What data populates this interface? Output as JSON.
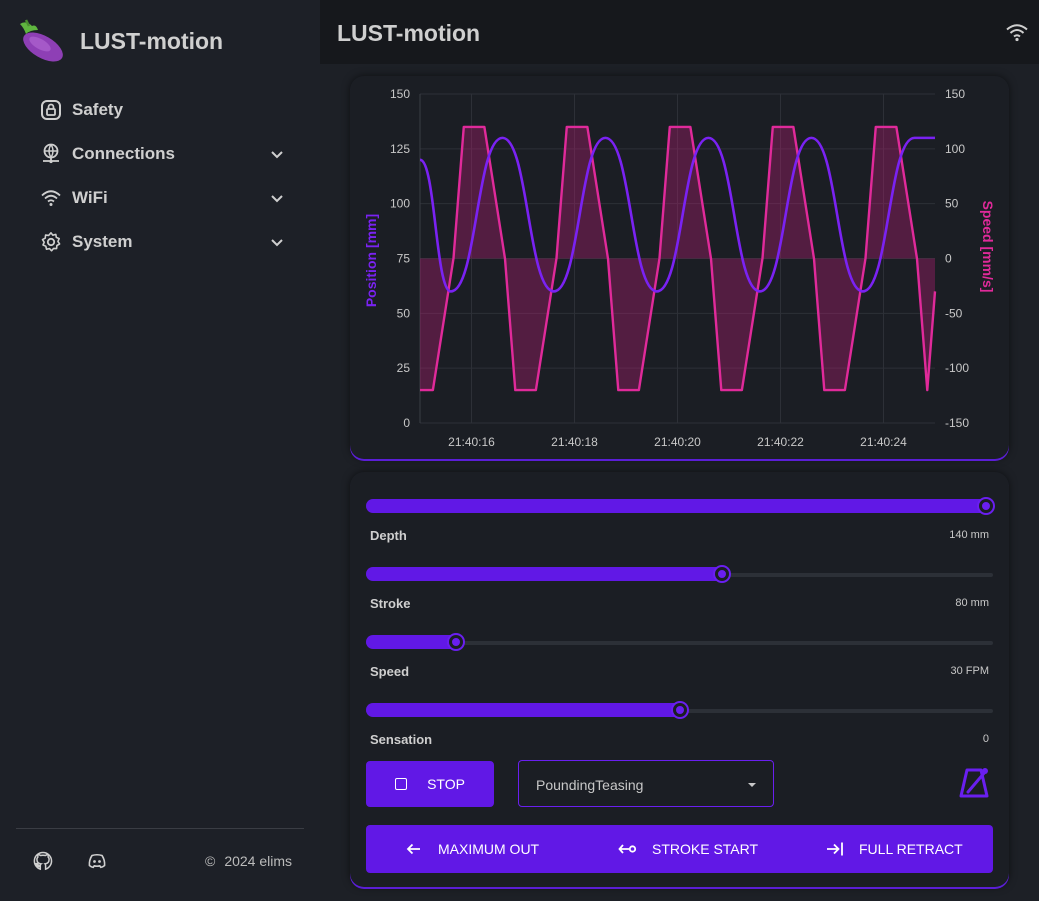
{
  "app": {
    "title": "LUST-motion"
  },
  "sidebar": {
    "items": [
      {
        "label": "Safety",
        "icon": "lock-icon"
      },
      {
        "label": "Connections",
        "icon": "network-icon"
      },
      {
        "label": "WiFi",
        "icon": "wifi-icon"
      },
      {
        "label": "System",
        "icon": "gear-icon"
      }
    ],
    "footer": {
      "copyright": "2024 elims",
      "icons": [
        "github-icon",
        "discord-icon"
      ]
    }
  },
  "header": {
    "title": "LUST-motion",
    "status_icon": "wifi-icon"
  },
  "colors": {
    "accent": "#6118e6",
    "position_line": "#7a22f2",
    "speed_line": "#e02a9a",
    "speed_fill": "rgba(190, 30, 120, 0.35)"
  },
  "chart_data": {
    "type": "line",
    "title": "",
    "xlabel": "",
    "ylabel": "Position [mm]",
    "y2label": "Speed [mm/s]",
    "x_ticks": [
      "21:40:16",
      "21:40:18",
      "21:40:20",
      "21:40:22",
      "21:40:24"
    ],
    "ylim": [
      0,
      150
    ],
    "y2lim": [
      -150,
      150
    ],
    "y_ticks": [
      0,
      25,
      50,
      75,
      100,
      125,
      150
    ],
    "y2_ticks": [
      -150,
      -100,
      -50,
      0,
      50,
      100,
      150
    ],
    "grid": true,
    "series": [
      {
        "name": "Position [mm]",
        "axis": "left",
        "x": [
          "21:40:15.0",
          "21:40:15.6",
          "21:40:16.6",
          "21:40:17.6",
          "21:40:18.6",
          "21:40:19.6",
          "21:40:20.6",
          "21:40:21.6",
          "21:40:22.6",
          "21:40:23.6",
          "21:40:24.6",
          "21:40:25.0"
        ],
        "values": [
          120,
          60,
          130,
          60,
          130,
          60,
          130,
          60,
          130,
          60,
          130,
          130
        ]
      },
      {
        "name": "Speed [mm/s]",
        "axis": "right",
        "x": [
          "21:40:15.0",
          "21:40:15.05",
          "21:40:15.25",
          "21:40:15.65",
          "21:40:15.85",
          "21:40:16.05",
          "21:40:16.25",
          "21:40:16.65",
          "21:40:16.85",
          "21:40:17.05",
          "21:40:17.25",
          "21:40:17.65",
          "21:40:17.85",
          "21:40:18.05",
          "21:40:18.25",
          "21:40:18.65",
          "21:40:18.85",
          "21:40:19.05",
          "21:40:19.25",
          "21:40:19.65",
          "21:40:19.85",
          "21:40:20.05",
          "21:40:20.25",
          "21:40:20.65",
          "21:40:20.85",
          "21:40:21.05",
          "21:40:21.25",
          "21:40:21.65",
          "21:40:21.85",
          "21:40:22.05",
          "21:40:22.25",
          "21:40:22.65",
          "21:40:22.85",
          "21:40:23.05",
          "21:40:23.25",
          "21:40:23.65",
          "21:40:23.85",
          "21:40:24.05",
          "21:40:24.25",
          "21:40:24.65",
          "21:40:24.85",
          "21:40:25.0"
        ],
        "values": [
          -120,
          -120,
          -120,
          0,
          120,
          120,
          120,
          0,
          -120,
          -120,
          -120,
          0,
          120,
          120,
          120,
          0,
          -120,
          -120,
          -120,
          0,
          120,
          120,
          120,
          0,
          -120,
          -120,
          -120,
          0,
          120,
          120,
          120,
          0,
          -120,
          -120,
          -120,
          0,
          120,
          120,
          120,
          0,
          -120,
          -30
        ]
      }
    ]
  },
  "controls": {
    "sliders": [
      {
        "label": "Depth",
        "value": "140 mm",
        "fraction": 1.0
      },
      {
        "label": "Stroke",
        "value": "80 mm",
        "fraction": 0.57
      },
      {
        "label": "Speed",
        "value": "30 FPM",
        "fraction": 0.135
      },
      {
        "label": "Sensation",
        "value": "0",
        "fraction": 0.5
      }
    ],
    "stop_label": "STOP",
    "pattern": {
      "selected": "PoundingTeasing"
    },
    "actions": [
      {
        "label": "MAXIMUM OUT",
        "icon": "arrow-left-icon"
      },
      {
        "label": "STROKE START",
        "icon": "stroke-start-icon"
      },
      {
        "label": "FULL RETRACT",
        "icon": "retract-icon"
      }
    ]
  }
}
